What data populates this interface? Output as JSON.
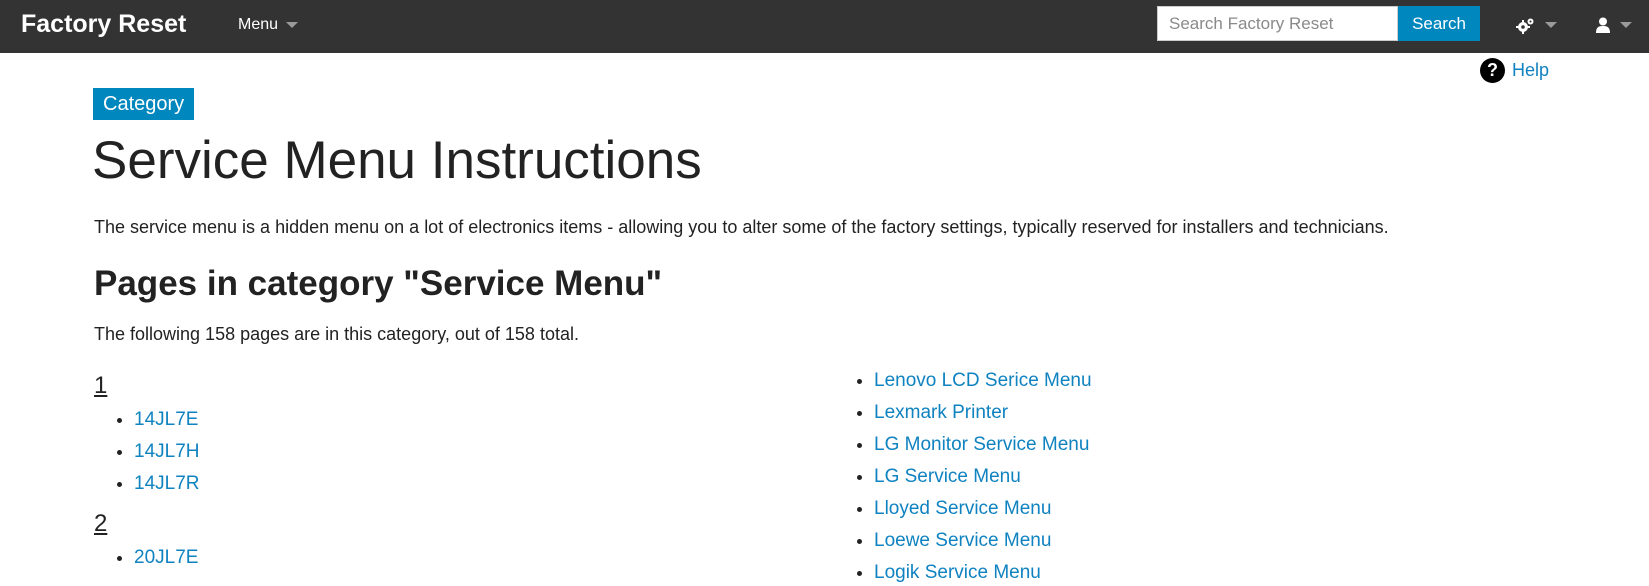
{
  "header": {
    "brand": "Factory Reset",
    "menu_label": "Menu",
    "search_placeholder": "Search Factory Reset",
    "search_button": "Search",
    "tools_icon": "gears-icon",
    "user_icon": "user-icon"
  },
  "help": {
    "badge": "?",
    "label": "Help"
  },
  "content": {
    "category_badge": "Category",
    "title": "Service Menu Instructions",
    "intro": "The service menu is a hidden menu on a lot of electronics items - allowing you to alter some of the factory settings, typically reserved for installers and technicians.",
    "section_title": "Pages in category \"Service Menu\"",
    "count_text": "The following 158 pages are in this category, out of 158 total."
  },
  "groups": [
    {
      "heading": "1",
      "items": [
        "14JL7E",
        "14JL7H",
        "14JL7R"
      ]
    },
    {
      "heading": "2",
      "items": [
        "20JL7E"
      ]
    }
  ],
  "right_column": [
    "Lenovo LCD Serice Menu",
    "Lexmark Printer",
    "LG Monitor Service Menu",
    "LG Service Menu",
    "Lloyed Service Menu",
    "Loewe Service Menu",
    "Logik Service Menu"
  ],
  "colors": {
    "topbar": "#333333",
    "accent": "#0087be",
    "link": "#0f82c0"
  }
}
